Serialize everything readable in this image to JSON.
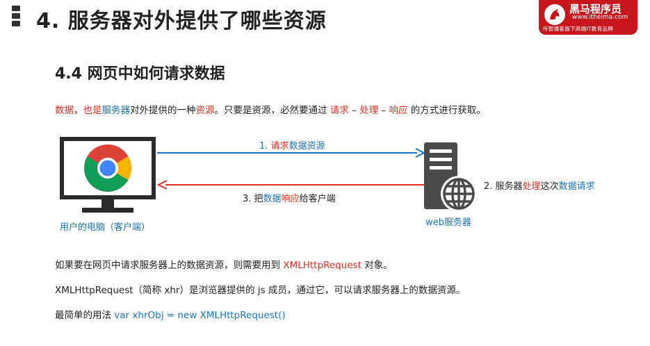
{
  "header": {
    "title": "4. 服务器对外提供了哪些资源",
    "logo": {
      "brand": "黑马程序员",
      "site": "www.itheima.com",
      "slogan": "传智播客旗下高端IT教育品牌"
    }
  },
  "section": {
    "title": "4.4 网页中如何请求数据"
  },
  "intro": {
    "t1": "数据",
    "t2": "，",
    "t3": "也是",
    "t4": "服务器",
    "t5": "对外提供的一种",
    "t6": "资源",
    "t7": "。只要是资源，必然要通过 ",
    "t8": "请求",
    "t9": " – ",
    "t10": "处理",
    "t11": " – ",
    "t12": "响应",
    "t13": " 的方式进行获取。"
  },
  "diagram": {
    "client_label": "用户的电脑（客户端）",
    "server_label": "web服务器",
    "step1": {
      "prefix": "1. ",
      "a": "请求",
      "b": "数据资源"
    },
    "step2": {
      "prefix": "2. 服务器",
      "a": "处理",
      "b": "这次",
      "c": "数据请求"
    },
    "step3": {
      "prefix": "3. 把",
      "a": "数据",
      "b": "响应",
      "c": "给客户端"
    },
    "colors": {
      "request": "#1a73c8",
      "response": "#e0301e",
      "server": "#4a4a4a"
    }
  },
  "paragraphs": {
    "p1": {
      "a": "如果要在网页中请求服务器上的数据资源，则需要用到 ",
      "b": "XMLHttpRequest",
      "c": " 对象。"
    },
    "p2": {
      "a": "XMLHttpRequest（简称 xhr）是浏览器提供的 js 成员，通过它，可以请求服务器上的数据资源。"
    },
    "p3": {
      "a": "最简单的用法 ",
      "b": "var xhrObj = new XMLHttpRequest()"
    }
  }
}
